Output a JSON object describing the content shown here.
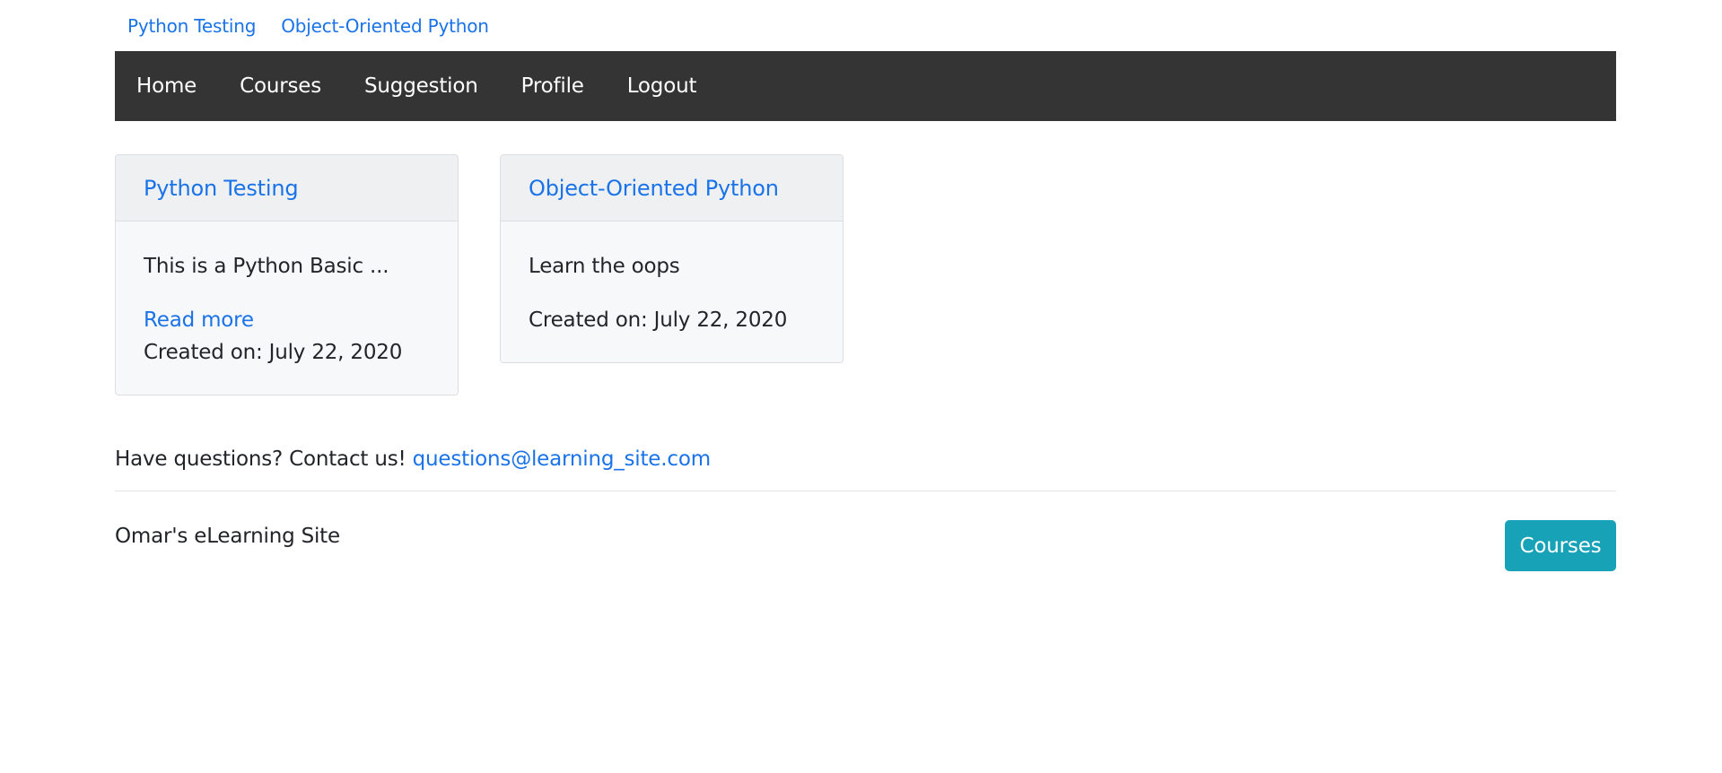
{
  "top_links": [
    {
      "label": "Python Testing"
    },
    {
      "label": "Object-Oriented Python"
    }
  ],
  "navbar": {
    "items": [
      {
        "label": "Home"
      },
      {
        "label": "Courses"
      },
      {
        "label": "Suggestion"
      },
      {
        "label": "Profile"
      },
      {
        "label": "Logout"
      }
    ],
    "background": "#343434"
  },
  "courses": [
    {
      "title": "Python Testing",
      "description": "This is a Python Basic ...",
      "read_more": "Read more",
      "created": "Created on: July 22, 2020"
    },
    {
      "title": "Object-Oriented Python",
      "description": "Learn the oops",
      "created": "Created on: July 22, 2020"
    }
  ],
  "footer": {
    "contact_text": "Have questions? Contact us!",
    "contact_email": "questions@learning_site.com",
    "site_name": "Omar's eLearning Site",
    "courses_button": "Courses"
  },
  "colors": {
    "link": "#1a73e8",
    "button": "#17a2b8",
    "card_bg": "#f7f8f9"
  }
}
